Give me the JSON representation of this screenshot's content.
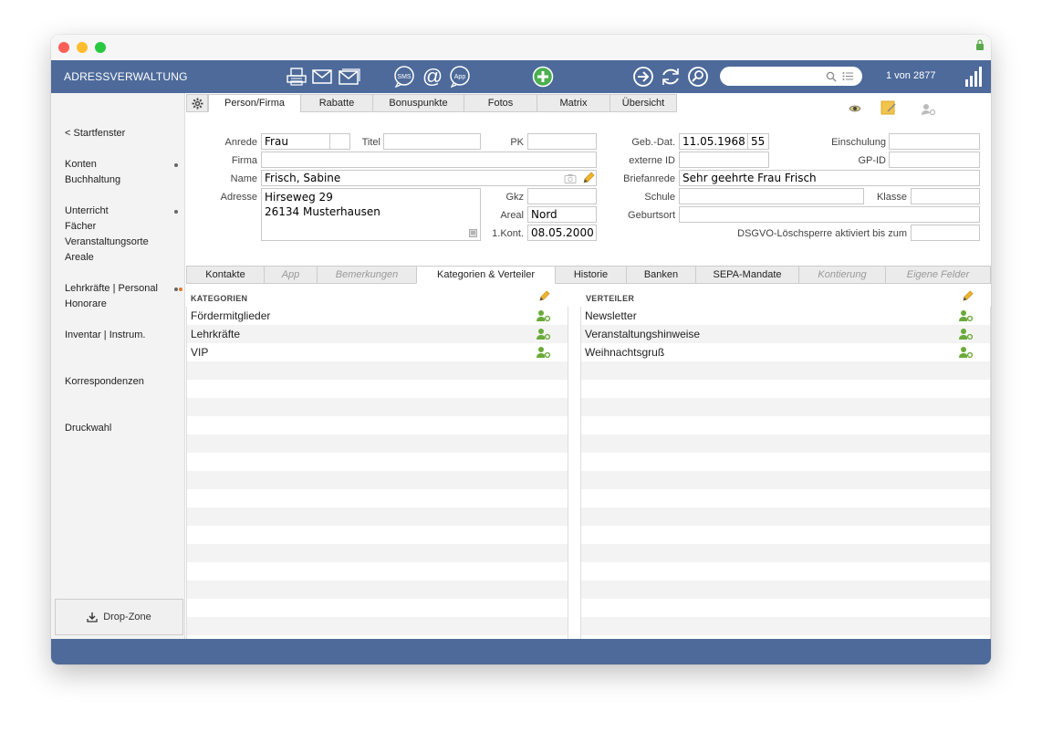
{
  "app": {
    "title": "ADRESSVERWALTUNG",
    "record_info": "1 von 2877",
    "search": {
      "value": "",
      "placeholder": ""
    }
  },
  "toolbar": {
    "icons": [
      "printer-icon",
      "mail-icon",
      "mail-multiple-icon",
      "sms-icon",
      "at-icon",
      "app-icon",
      "add-icon",
      "forward-icon",
      "refresh-icon",
      "search-icon"
    ],
    "sms": "SMS",
    "app": "App"
  },
  "sidebar": {
    "back": "< Startfenster",
    "items": [
      "Konten",
      "Buchhaltung",
      "Unterricht",
      "Fächer",
      "Veranstaltungsorte",
      "Areale",
      "Lehrkräfte | Personal",
      "Honorare",
      "Inventar | Instrum.",
      "Korrespondenzen",
      "Druckwahl"
    ],
    "dropzone": "Drop-Zone"
  },
  "top_tabs": [
    "Person/Firma",
    "Rabatte",
    "Bonuspunkte",
    "Fotos",
    "Matrix",
    "Übersicht"
  ],
  "form": {
    "labels": {
      "anrede": "Anrede",
      "titel": "Titel",
      "pk": "PK",
      "firma": "Firma",
      "name": "Name",
      "adresse": "Adresse",
      "gkz": "Gkz",
      "areal": "Areal",
      "kont": "1.Kont.",
      "gebdat": "Geb.-Dat.",
      "externe_id": "externe ID",
      "briefanrede": "Briefanrede",
      "schule": "Schule",
      "geburtsort": "Geburtsort",
      "einschulung": "Einschulung",
      "gpid": "GP-ID",
      "klasse": "Klasse",
      "dsgvo": "DSGVO-Löschsperre aktiviert bis zum"
    },
    "values": {
      "anrede": "Frau",
      "anrede2": "",
      "titel": "",
      "pk": "",
      "firma": "",
      "name": "Frisch, Sabine",
      "adresse_line1": "Hirseweg 29",
      "adresse_line2": "26134 Musterhausen",
      "gkz": "",
      "areal": "Nord",
      "kont": "08.05.2000",
      "gebdat": "11.05.1968",
      "alter": "55",
      "externe_id": "",
      "briefanrede": "Sehr geehrte Frau Frisch",
      "schule": "",
      "geburtsort": "",
      "einschulung": "",
      "gpid": "",
      "klasse": "",
      "dsgvo": ""
    }
  },
  "lower_tabs": [
    {
      "label": "Kontakte",
      "enabled": true
    },
    {
      "label": "App",
      "enabled": false
    },
    {
      "label": "Bemerkungen",
      "enabled": false
    },
    {
      "label": "Kategorien & Verteiler",
      "enabled": true,
      "active": true
    },
    {
      "label": "Historie",
      "enabled": true
    },
    {
      "label": "Banken",
      "enabled": true
    },
    {
      "label": "SEPA-Mandate",
      "enabled": true
    },
    {
      "label": "Kontierung",
      "enabled": false
    },
    {
      "label": "Eigene Felder",
      "enabled": false
    }
  ],
  "kategorien": {
    "title": "KATEGORIEN",
    "items": [
      "Fördermitglieder",
      "Lehrkräfte",
      "VIP"
    ]
  },
  "verteiler": {
    "title": "VERTEILER",
    "items": [
      "Newsletter",
      "Veranstaltungshinweise",
      "Weihnachtsgruß"
    ]
  },
  "colors": {
    "topbar": "#4d6a9a",
    "accent_green": "#4caf50",
    "row_alt": "#f3f3f3"
  }
}
